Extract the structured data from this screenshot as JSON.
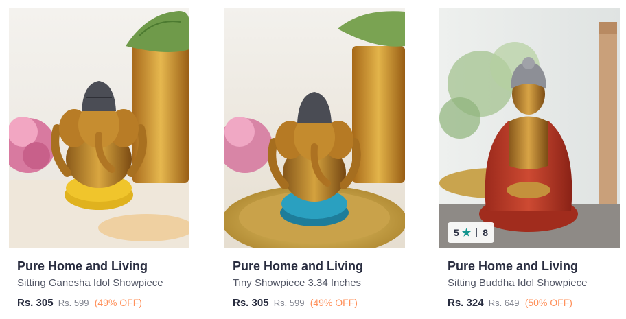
{
  "products": [
    {
      "brand": "Pure Home and Living",
      "title": "Sitting Ganesha Idol Showpiece",
      "price": "Rs. 305",
      "mrp": "Rs. 599",
      "discount": "(49% OFF)",
      "image": "ganesha-idol-yellow"
    },
    {
      "brand": "Pure Home and Living",
      "title": "Tiny Showpiece 3.34 Inches",
      "price": "Rs. 305",
      "mrp": "Rs. 599",
      "discount": "(49% OFF)",
      "image": "ganesha-idol-blue"
    },
    {
      "brand": "Pure Home and Living",
      "title": "Sitting Buddha Idol Showpiece",
      "price": "Rs. 324",
      "mrp": "Rs. 649",
      "discount": "(50% OFF)",
      "image": "buddha-idol-red",
      "rating": {
        "value": "5",
        "count": "8",
        "icon": "star-icon"
      }
    }
  ],
  "colors": {
    "brand_text": "#282c3f",
    "secondary_text": "#535766",
    "mrp_text": "#7e818c",
    "discount_text": "#ff905a",
    "rating_star": "#14958f"
  }
}
